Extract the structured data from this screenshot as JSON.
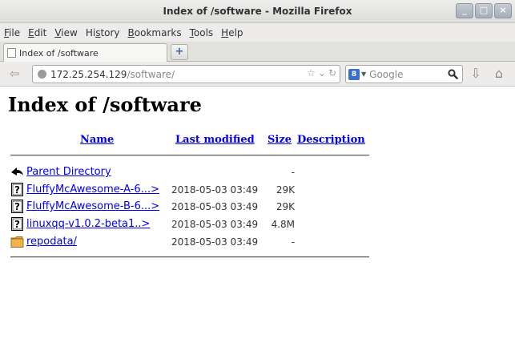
{
  "window": {
    "title": "Index of /software - Mozilla Firefox",
    "controls": [
      "minimize-icon",
      "maximize-icon",
      "close-icon"
    ]
  },
  "menubar": {
    "items": [
      {
        "label": "File",
        "accel": "F",
        "rest": "ile"
      },
      {
        "label": "Edit",
        "accel": "E",
        "rest": "dit"
      },
      {
        "label": "View",
        "accel": "V",
        "rest": "iew"
      },
      {
        "label": "History",
        "pre": "Hi",
        "accel": "s",
        "rest": "tory"
      },
      {
        "label": "Bookmarks",
        "accel": "B",
        "rest": "ookmarks"
      },
      {
        "label": "Tools",
        "accel": "T",
        "rest": "ools"
      },
      {
        "label": "Help",
        "accel": "H",
        "rest": "elp"
      }
    ]
  },
  "tabs": [
    {
      "label": "Index of /software",
      "active": true
    }
  ],
  "navbar": {
    "url_host": "172.25.254.129",
    "url_path": "/software/",
    "search_placeholder": "Google",
    "search_engine_letter": "8"
  },
  "page": {
    "title": "Index of /software",
    "columns": {
      "name": "Name",
      "last_modified": "Last modified",
      "size": "Size",
      "description": "Description"
    },
    "rows": [
      {
        "icon": "back-icon",
        "name": "Parent Directory",
        "date": "",
        "size": "-"
      },
      {
        "icon": "unknown-file-icon",
        "name": "FluffyMcAwesome-A-6...>",
        "date": "2018-05-03 03:49",
        "size": "29K"
      },
      {
        "icon": "unknown-file-icon",
        "name": "FluffyMcAwesome-B-6...>",
        "date": "2018-05-03 03:49",
        "size": "29K"
      },
      {
        "icon": "unknown-file-icon",
        "name": "linuxqq-v1.0.2-beta1..>",
        "date": "2018-05-03 03:49",
        "size": "4.8M"
      },
      {
        "icon": "folder-icon",
        "name": "repodata/",
        "date": "2018-05-03 03:49",
        "size": "-"
      }
    ]
  },
  "colors": {
    "link": "#0000ee",
    "titlebar": "#e4e4e0",
    "chrome": "#edeceb"
  }
}
